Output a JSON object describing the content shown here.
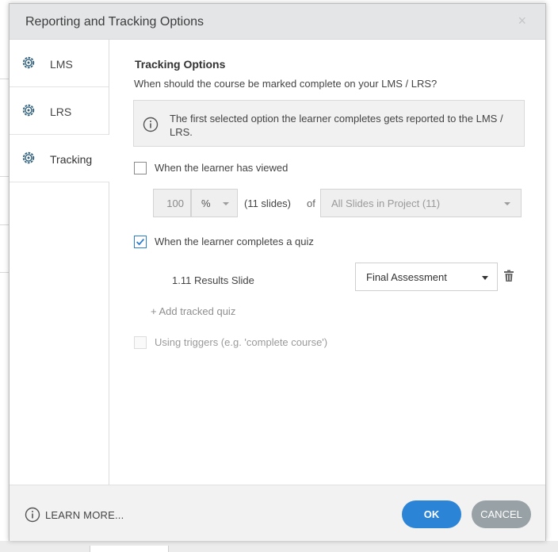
{
  "dialog": {
    "title": "Reporting and Tracking Options",
    "close_symbol": "×"
  },
  "sidebar": {
    "items": [
      {
        "label": "LMS",
        "icon": "gear-icon"
      },
      {
        "label": "LRS",
        "icon": "gear-icon"
      },
      {
        "label": "Tracking",
        "icon": "gear-icon",
        "active": true
      }
    ]
  },
  "tracking": {
    "section_title": "Tracking Options",
    "question": "When should the course be marked complete on your LMS / LRS?",
    "info_text": "The first selected option the learner completes gets reported to the LMS / LRS.",
    "viewed": {
      "checked": false,
      "label": "When the learner has viewed",
      "percent_value": "100",
      "unit_selected": "%",
      "slides_count": "(11 slides)",
      "of_label": "of",
      "scope_selected": "All Slides in Project (11)"
    },
    "quiz": {
      "checked": true,
      "label": "When the learner completes a quiz",
      "slide_name": "1.11 Results Slide",
      "quiz_selected": "Final Assessment",
      "add_label": "+ Add tracked quiz"
    },
    "triggers": {
      "checked": false,
      "disabled": true,
      "label": "Using triggers (e.g. 'complete course')"
    }
  },
  "footer": {
    "learn_more": "LEARN MORE...",
    "ok_label": "OK",
    "cancel_label": "CANCEL"
  },
  "colors": {
    "accent": "#2b84d6",
    "cancel": "#97a1a6",
    "titlebar": "#e3e5e7"
  }
}
